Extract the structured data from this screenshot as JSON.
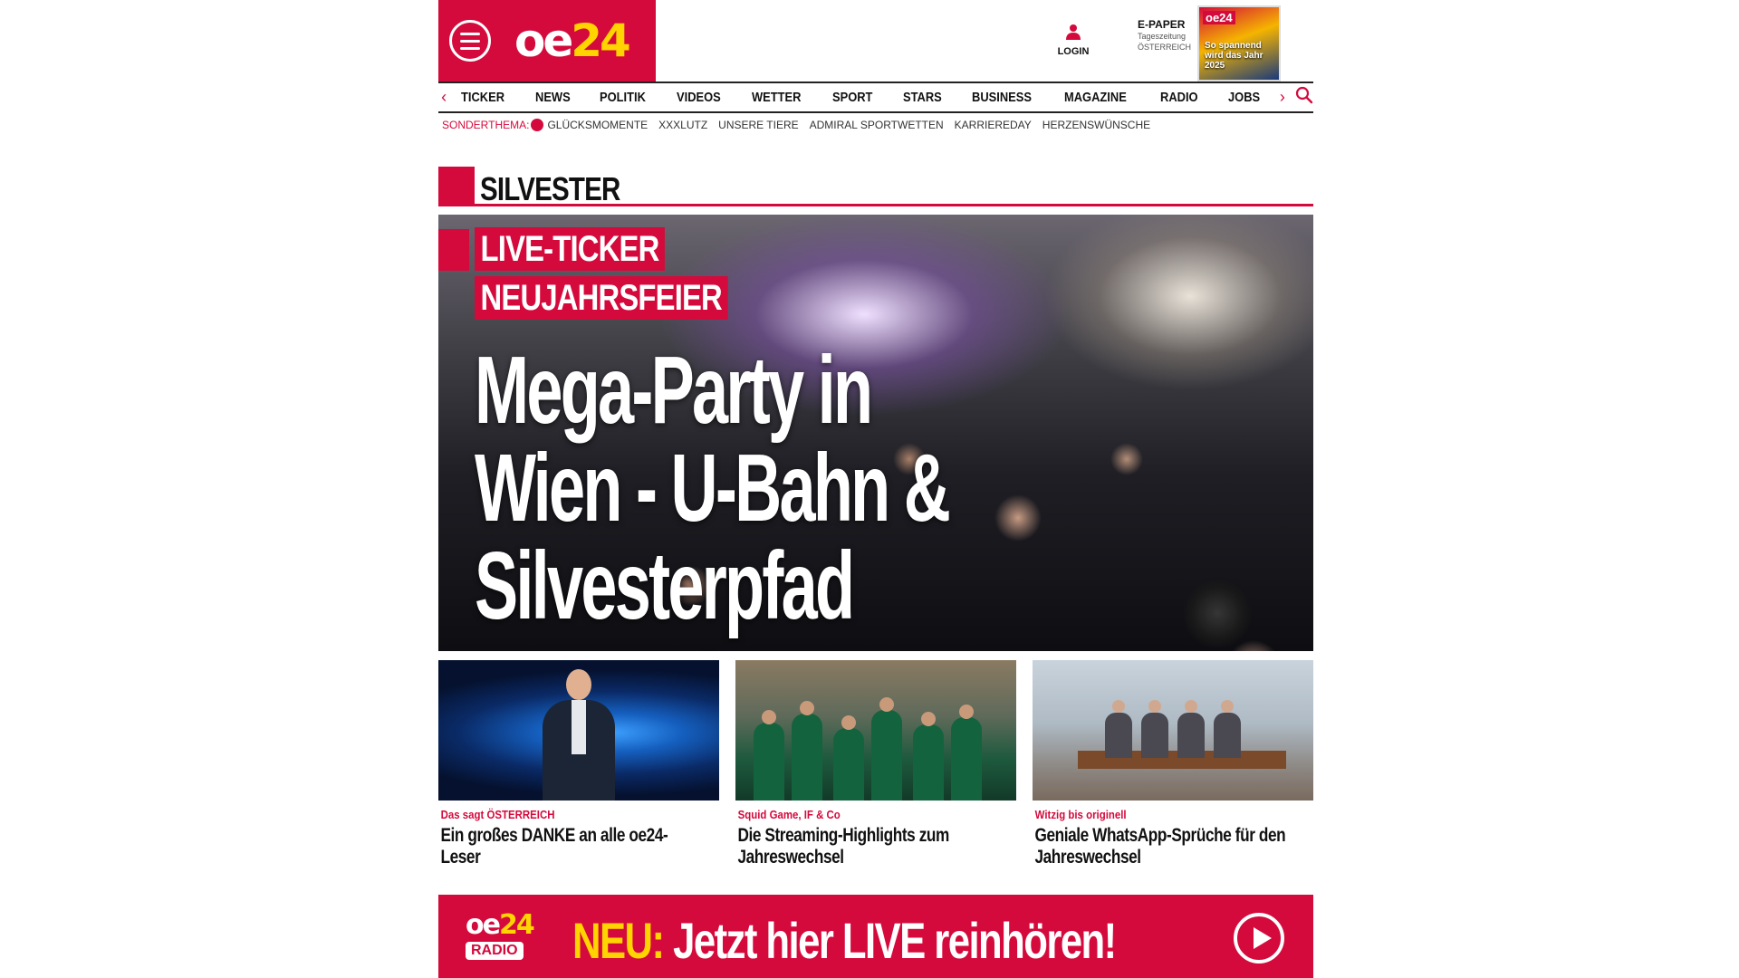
{
  "header": {
    "logo_text_main": "oe",
    "logo_text_accent": "24",
    "login_label": "LOGIN",
    "epaper_title": "E-PAPER",
    "epaper_sub1": "Tageszeitung",
    "epaper_sub2": "ÖSTERREICH",
    "epaper_cover_brand": "oe24",
    "epaper_cover_headline": "So spannend wird das Jahr 2025"
  },
  "nav": {
    "items": [
      "TICKER",
      "NEWS",
      "POLITIK",
      "VIDEOS",
      "WETTER",
      "SPORT",
      "STARS",
      "BUSINESS",
      "MAGAZINE",
      "RADIO",
      "JOBS"
    ],
    "left_arrow": "‹",
    "right_arrow": "›"
  },
  "subnav": {
    "label": "SONDERTHEMA:",
    "items": [
      "GLÜCKSMOMENTE",
      "XXXLUTZ",
      "UNSERE TIERE",
      "ADMIRAL SPORTWETTEN",
      "KARRIEREDAY",
      "HERZENSWÜNSCHE"
    ]
  },
  "section": {
    "title": "SILVESTER"
  },
  "hero": {
    "tag1": "LIVE-TICKER",
    "tag2": "NEUJAHRSFEIER",
    "headline_line1": "Mega-Party in",
    "headline_line2": "Wien - U-Bahn &",
    "headline_line3": "Silvesterpfad gesperrt"
  },
  "cards": [
    {
      "kicker": "Das sagt ÖSTERREICH",
      "title": "Ein großes DANKE an alle oe24-Leser"
    },
    {
      "kicker": "Squid Game, IF & Co",
      "title": "Die Streaming-Highlights zum Jahreswechsel"
    },
    {
      "kicker": "Witzig bis originell",
      "title": "Geniale WhatsApp-Sprüche für den Jahreswechsel"
    }
  ],
  "radio": {
    "logo_main": "oe",
    "logo_accent": "24",
    "logo_tag": "RADIO",
    "neu": "NEU:",
    "text": "Jetzt hier LIVE reinhören!"
  },
  "colors": {
    "brand_red": "#d40a3c",
    "brand_yellow": "#ffd400"
  }
}
